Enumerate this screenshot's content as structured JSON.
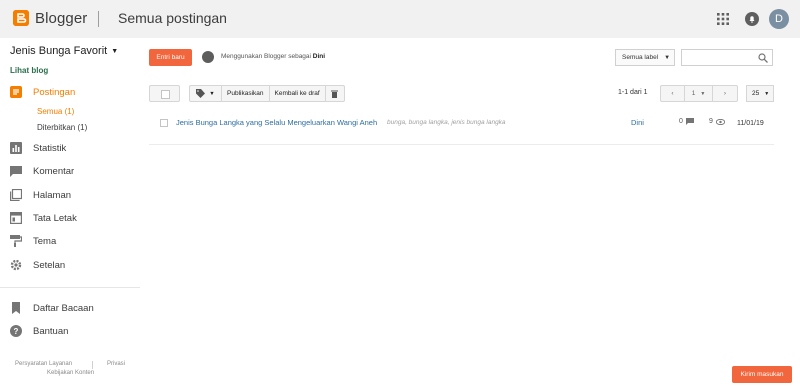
{
  "topbar": {
    "brand": "Blogger",
    "title": "Semua postingan",
    "avatar_letter": "D",
    "icons": [
      "blogger-logo-icon",
      "apps-grid-icon",
      "notification-bell-icon"
    ]
  },
  "sidebar": {
    "blog_name": "Jenis Bunga Favorit",
    "view_blog": "Lihat blog",
    "items": [
      {
        "label": "Postingan",
        "icon": "posts-icon",
        "active": true
      },
      {
        "label": "Statistik",
        "icon": "stats-icon"
      },
      {
        "label": "Komentar",
        "icon": "comment-icon"
      },
      {
        "label": "Halaman",
        "icon": "pages-icon"
      },
      {
        "label": "Tata Letak",
        "icon": "layout-icon"
      },
      {
        "label": "Tema",
        "icon": "theme-icon"
      },
      {
        "label": "Setelan",
        "icon": "settings-icon"
      },
      {
        "label": "Daftar Bacaan",
        "icon": "bookmark-icon"
      },
      {
        "label": "Bantuan",
        "icon": "help-icon"
      }
    ],
    "subitems": [
      {
        "label": "Semua (1)",
        "active": true
      },
      {
        "label": "Diterbitkan (1)"
      }
    ],
    "footer": {
      "terms": "Persyaratan Layanan",
      "privacy": "Privasi",
      "content_policy": "Kebijakan Konten"
    }
  },
  "header": {
    "new_post": "Entri baru",
    "using_prefix": "Menggunakan Blogger sebagai",
    "using_name": "Dini",
    "label_filter": "Semua label",
    "search_placeholder": ""
  },
  "toolbar": {
    "publish": "Publikasikan",
    "revert_draft": "Kembali ke draf",
    "range": "1-1 dari 1",
    "page": "1",
    "per_page": "25"
  },
  "posts": [
    {
      "title": "Jenis Bunga Langka yang Selalu Mengeluarkan Wangi Aneh",
      "labels": "bunga, bunga langka, jenis bunga langka",
      "author": "Dini",
      "comments": "0",
      "views": "9",
      "date": "11/01/19"
    }
  ],
  "feedback": "Kirim masukan",
  "colors": {
    "accent": "#f57d00",
    "button": "#f1663c",
    "link": "#2f6e9e"
  }
}
